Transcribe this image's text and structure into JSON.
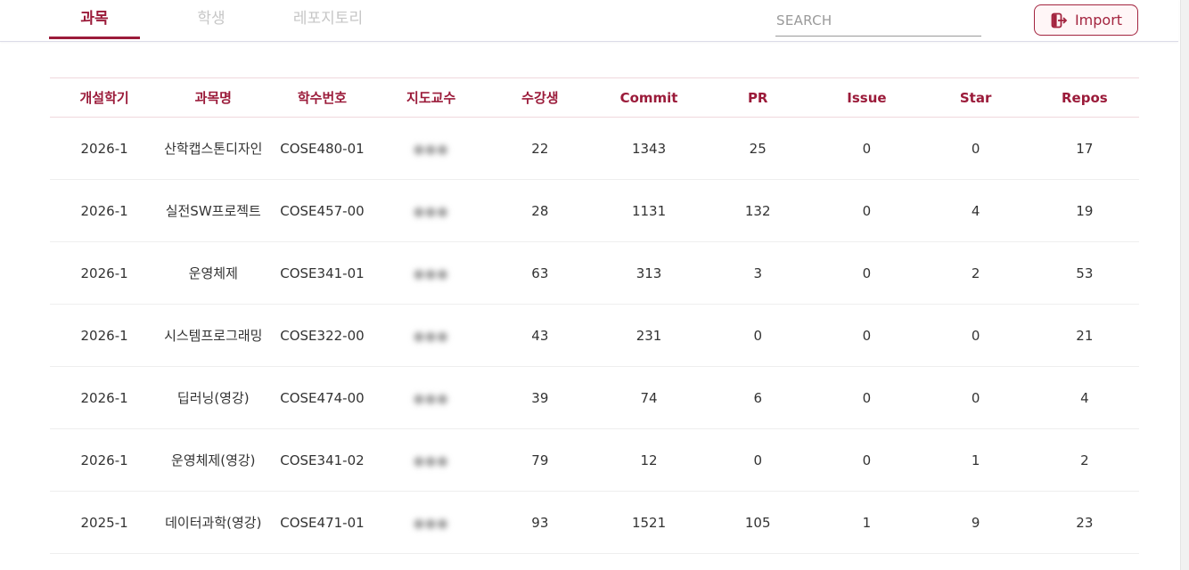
{
  "tabs": {
    "course": "과목",
    "student": "학생",
    "repository": "레포지토리"
  },
  "search": {
    "placeholder": "SEARCH"
  },
  "import_button": {
    "label": "Import"
  },
  "colors": {
    "accent": "#9b1b3a",
    "inactive_tab": "#c6c6c6"
  },
  "table": {
    "headers": [
      "개설학기",
      "과목명",
      "학수번호",
      "지도교수",
      "수강생",
      "Commit",
      "PR",
      "Issue",
      "Star",
      "Repos"
    ],
    "rows": [
      {
        "semester": "2026-1",
        "name": "산학캡스톤디자인",
        "code": "COSE480-01",
        "professor": "●●●",
        "students": "22",
        "commit": "1343",
        "pr": "25",
        "issue": "0",
        "star": "0",
        "repos": "17"
      },
      {
        "semester": "2026-1",
        "name": "실전SW프로젝트",
        "code": "COSE457-00",
        "professor": "●●●",
        "students": "28",
        "commit": "1131",
        "pr": "132",
        "issue": "0",
        "star": "4",
        "repos": "19"
      },
      {
        "semester": "2026-1",
        "name": "운영체제",
        "code": "COSE341-01",
        "professor": "●●●",
        "students": "63",
        "commit": "313",
        "pr": "3",
        "issue": "0",
        "star": "2",
        "repos": "53"
      },
      {
        "semester": "2026-1",
        "name": "시스템프로그래밍",
        "code": "COSE322-00",
        "professor": "●●●",
        "students": "43",
        "commit": "231",
        "pr": "0",
        "issue": "0",
        "star": "0",
        "repos": "21"
      },
      {
        "semester": "2026-1",
        "name": "딥러닝(영강)",
        "code": "COSE474-00",
        "professor": "●●●",
        "students": "39",
        "commit": "74",
        "pr": "6",
        "issue": "0",
        "star": "0",
        "repos": "4"
      },
      {
        "semester": "2026-1",
        "name": "운영체제(영강)",
        "code": "COSE341-02",
        "professor": "●●●",
        "students": "79",
        "commit": "12",
        "pr": "0",
        "issue": "0",
        "star": "1",
        "repos": "2"
      },
      {
        "semester": "2025-1",
        "name": "데이터과학(영강)",
        "code": "COSE471-01",
        "professor": "●●●",
        "students": "93",
        "commit": "1521",
        "pr": "105",
        "issue": "1",
        "star": "9",
        "repos": "23"
      }
    ]
  }
}
